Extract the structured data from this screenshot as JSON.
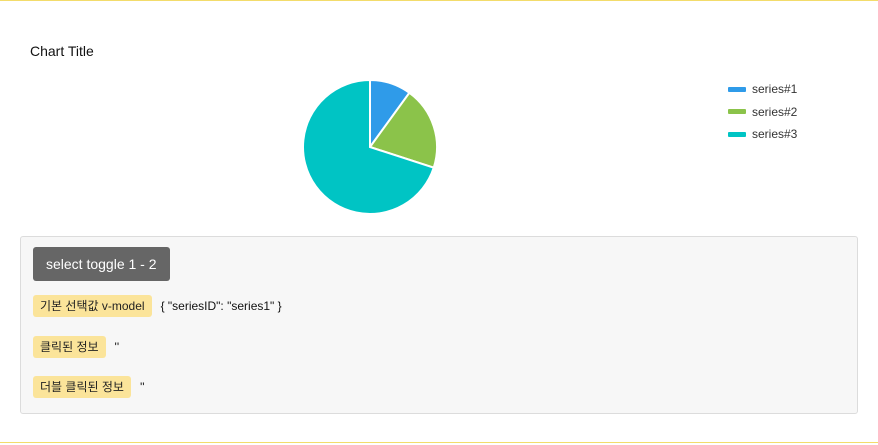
{
  "chart_data": {
    "type": "pie",
    "title": "Chart Title",
    "series": [
      {
        "name": "series#1",
        "value": 10,
        "color": "#2f9be9"
      },
      {
        "name": "series#2",
        "value": 20,
        "color": "#8bc34a"
      },
      {
        "name": "series#3",
        "value": 70,
        "color": "#00c4c4"
      }
    ],
    "legend_position": "top-right"
  },
  "panel": {
    "toggle_label": "select toggle 1 - 2",
    "rows": [
      {
        "label": "기본 선택값 v-model",
        "value": "{ \"seriesID\": \"series1\" }"
      },
      {
        "label": "클릭된 정보",
        "value": "''"
      },
      {
        "label": "더블 클릭된 정보",
        "value": "''"
      }
    ]
  },
  "colors": {
    "accent_rule": "#f3dc6b",
    "button_bg": "#666666",
    "tag_bg": "#fbe49a",
    "panel_bg": "#f7f7f7"
  }
}
